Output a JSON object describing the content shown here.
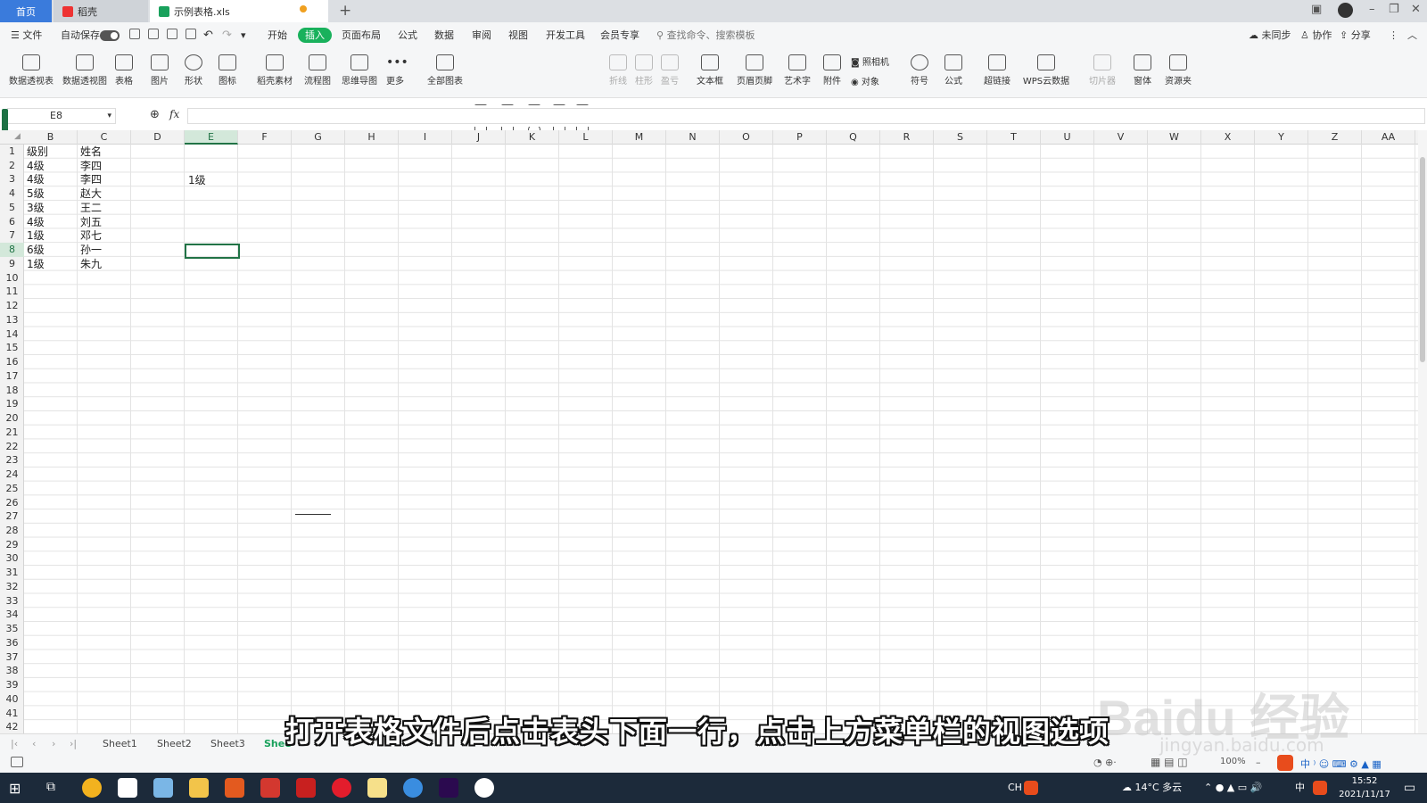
{
  "tabs": {
    "home": "首页",
    "daoke": "稻壳",
    "file": "示例表格.xls"
  },
  "menu": {
    "file": "文件",
    "autosave": "自动保存",
    "items": [
      "开始",
      "插入",
      "页面布局",
      "公式",
      "数据",
      "审阅",
      "视图",
      "开发工具",
      "会员专享"
    ],
    "search": "查找命令、搜索模板",
    "sync": "未同步",
    "collab": "协作",
    "share": "分享"
  },
  "ribbon": [
    "数据透视表",
    "数据透视图",
    "表格",
    "图片",
    "形状",
    "图标",
    "稻壳素材",
    "流程图",
    "思维导图",
    "更多",
    "全部图表",
    "折线",
    "柱形",
    "盈亏",
    "文本框",
    "页眉页脚",
    "艺术字",
    "附件",
    "照相机",
    "对象",
    "符号",
    "公式",
    "超链接",
    "WPS云数据",
    "切片器",
    "窗体",
    "资源夹"
  ],
  "formula": {
    "cell_ref": "E8",
    "fx": "fx"
  },
  "columns": [
    "B",
    "C",
    "D",
    "E",
    "F",
    "G",
    "H",
    "I",
    "J",
    "K",
    "L",
    "M",
    "N",
    "O",
    "P",
    "Q",
    "R",
    "S",
    "T",
    "U",
    "V",
    "W",
    "X",
    "Y",
    "Z",
    "AA"
  ],
  "rows": [
    "1",
    "2",
    "3",
    "4",
    "5",
    "6",
    "7",
    "8",
    "9",
    "10",
    "11",
    "12",
    "13",
    "14",
    "15",
    "16",
    "17",
    "18",
    "19",
    "20",
    "21",
    "22",
    "23",
    "24",
    "25",
    "26",
    "27",
    "28",
    "29",
    "30",
    "31",
    "32",
    "33",
    "34",
    "35",
    "36",
    "37",
    "38",
    "39",
    "40",
    "41",
    "42"
  ],
  "cells": {
    "b": [
      "级别",
      "4级",
      "4级",
      "5级",
      "3级",
      "4级",
      "1级",
      "6级",
      "1级"
    ],
    "c": [
      "姓名",
      "李四",
      "李四",
      "赵大",
      "王二",
      "刘五",
      "邓七",
      "孙一",
      "朱九"
    ],
    "e3": "1级"
  },
  "sheets": [
    "Sheet1",
    "Sheet2",
    "Sheet3",
    "Shee"
  ],
  "status": {
    "zoom": "100%"
  },
  "taskbar": {
    "lang": "CH",
    "weather": "14°C 多云",
    "ime": "中",
    "time": "15:52",
    "date": "2021/11/17"
  },
  "overlay": {
    "subtitle": "打开表格文件后点击表头下面一行，点击上方菜单栏的视图选项",
    "watermark": "Baidu 经验",
    "watermark_url": "jingyan.baidu.com"
  }
}
